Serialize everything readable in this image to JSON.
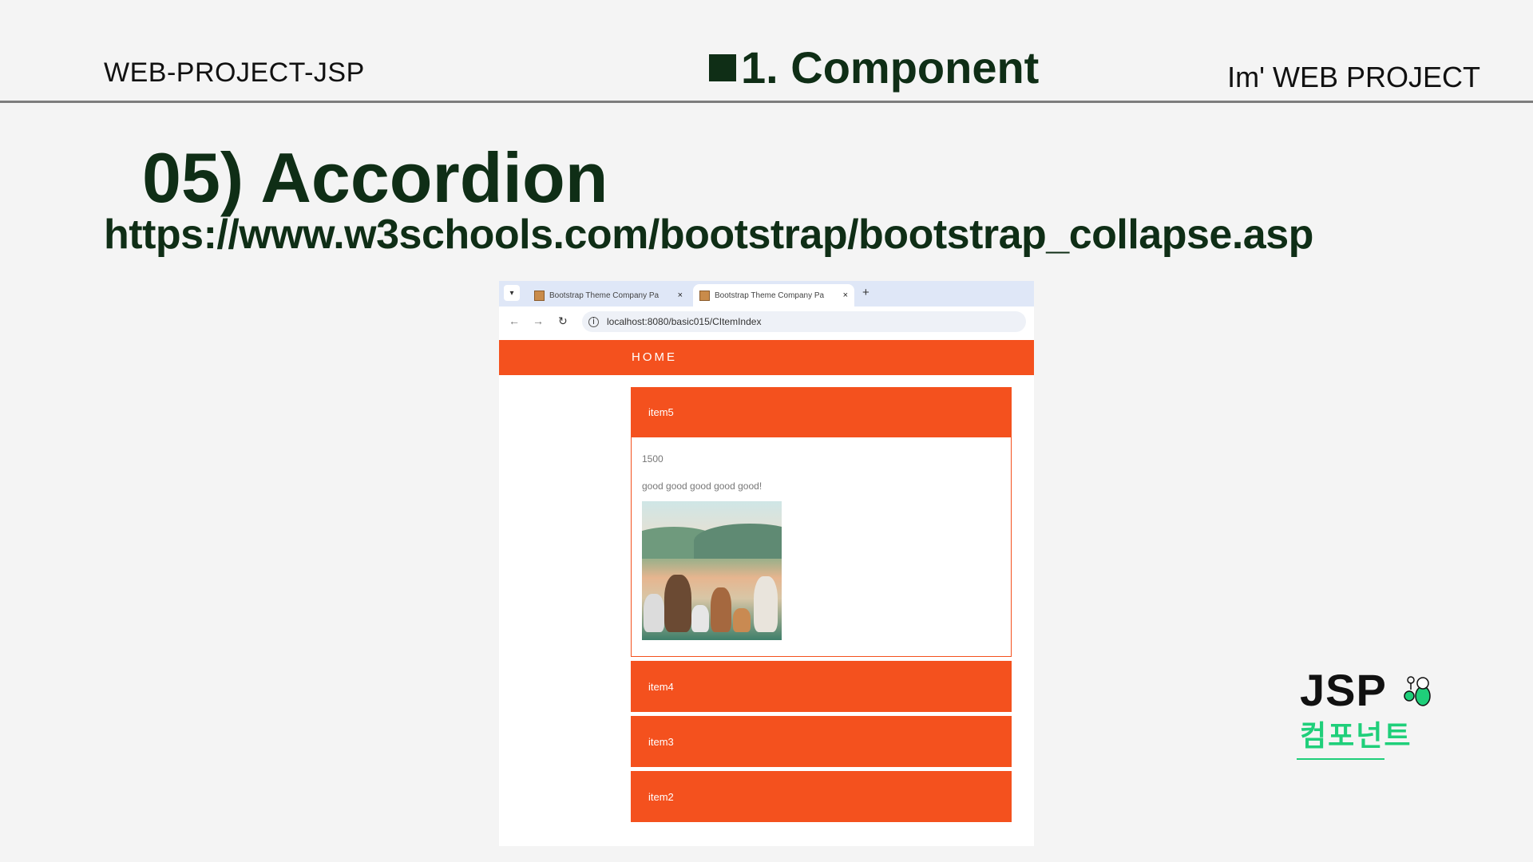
{
  "slide": {
    "left_title": "WEB-PROJECT-JSP",
    "center_title": "1. Component",
    "right_title": "Im' WEB PROJECT",
    "section_title": "05) Accordion",
    "section_url": "https://www.w3schools.com/bootstrap/bootstrap_collapse.asp"
  },
  "browser": {
    "tabs": [
      {
        "title": "Bootstrap Theme Company Pa"
      },
      {
        "title": "Bootstrap Theme Company Pa"
      }
    ],
    "tab_close": "×",
    "new_tab": "+",
    "url": "localhost:8080/basic015/CItemIndex"
  },
  "page": {
    "nav_home": "HOME",
    "accordion": {
      "open_item": {
        "title": "item5",
        "price": "1500",
        "description": "good good good good good!"
      },
      "collapsed_items": [
        "item4",
        "item3",
        "item2"
      ]
    }
  },
  "logo": {
    "jsp": "JSP",
    "korean": "컴포넌트"
  },
  "colors": {
    "accent": "#f4511e",
    "heading": "#0f2e16",
    "logo_green": "#1fcf7a"
  }
}
